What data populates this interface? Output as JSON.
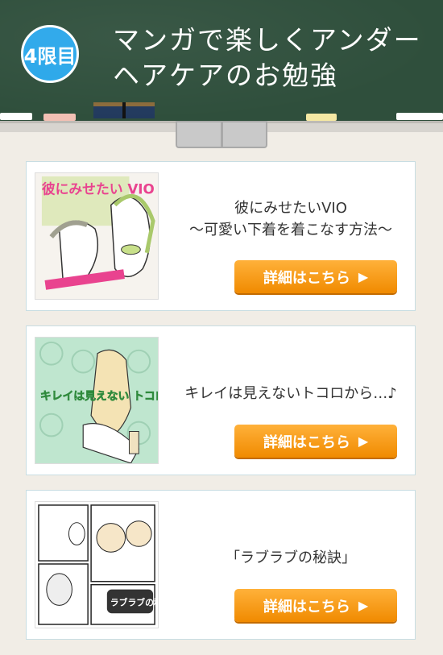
{
  "header": {
    "badge_text": "4限目",
    "title_line1": "マンガで楽しくアンダー",
    "title_line2": "ヘアケアのお勉強"
  },
  "cards": [
    {
      "title_line1": "彼にみせたいVIO",
      "title_line2": "〜可愛い下着を着こなす方法〜",
      "button_label": "詳細はこちら",
      "button_icon": "play-arrow-icon",
      "thumb_text": "彼にみせたい VIO"
    },
    {
      "title_line1": "キレイは見えないトコロから…♪",
      "button_label": "詳細はこちら",
      "button_icon": "play-arrow-icon",
      "thumb_text": "キレイは見えない トコロから…♪"
    },
    {
      "title_line1": "「ラブラブの秘訣」",
      "button_label": "詳細はこちら",
      "button_icon": "play-arrow-icon",
      "thumb_text": "ラブラブの秘訣"
    }
  ],
  "colors": {
    "board": "#2f4f3c",
    "badge": "#2aa7ea",
    "button": "#f39800"
  }
}
